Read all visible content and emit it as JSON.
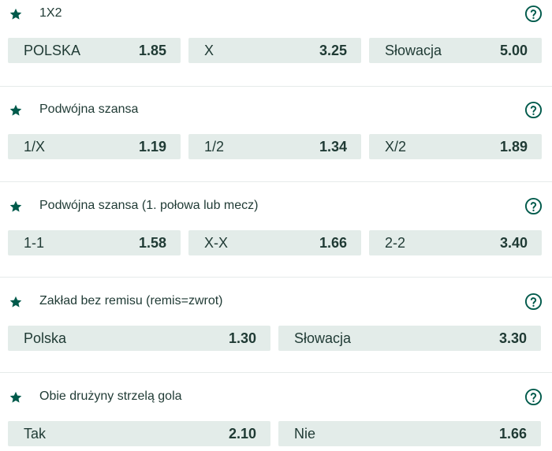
{
  "markets": [
    {
      "title": "1X2",
      "odds": [
        {
          "label": "POLSKA",
          "value": "1.85"
        },
        {
          "label": "X",
          "value": "3.25"
        },
        {
          "label": "Słowacja",
          "value": "5.00"
        }
      ]
    },
    {
      "title": "Podwójna szansa",
      "odds": [
        {
          "label": "1/X",
          "value": "1.19"
        },
        {
          "label": "1/2",
          "value": "1.34"
        },
        {
          "label": "X/2",
          "value": "1.89"
        }
      ]
    },
    {
      "title": "Podwójna szansa (1. połowa lub mecz)",
      "odds": [
        {
          "label": "1-1",
          "value": "1.58"
        },
        {
          "label": "X-X",
          "value": "1.66"
        },
        {
          "label": "2-2",
          "value": "3.40"
        }
      ]
    },
    {
      "title": "Zakład bez remisu (remis=zwrot)",
      "odds": [
        {
          "label": "Polska",
          "value": "1.30"
        },
        {
          "label": "Słowacja",
          "value": "3.30"
        }
      ]
    },
    {
      "title": "Obie drużyny strzelą gola",
      "odds": [
        {
          "label": "Tak",
          "value": "2.10"
        },
        {
          "label": "Nie",
          "value": "1.66"
        }
      ]
    }
  ],
  "icons": {
    "favorite": "star-icon",
    "help": "question-circle-icon"
  },
  "colors": {
    "accent": "#005a4b",
    "text": "#1f3a34",
    "odd_bg": "#e3ece9",
    "divider": "#e6ebea"
  }
}
